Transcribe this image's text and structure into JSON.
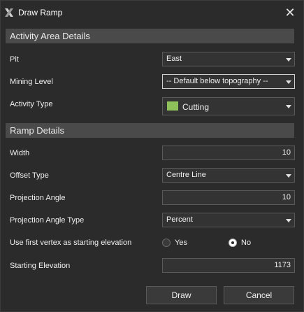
{
  "window": {
    "title": "Draw Ramp",
    "icon": "app-logo-icon",
    "close_icon": "close-icon",
    "close_symbol": "✕"
  },
  "activity_section": {
    "header": "Activity Area Details",
    "pit": {
      "label": "Pit",
      "value": "East"
    },
    "mining_level": {
      "label": "Mining Level",
      "value": "-- Default below topography --"
    },
    "activity_type": {
      "label": "Activity Type",
      "value": "Cutting",
      "swatch_color": "#8fc15a"
    }
  },
  "ramp_section": {
    "header": "Ramp Details",
    "width": {
      "label": "Width",
      "value": "10"
    },
    "offset_type": {
      "label": "Offset Type",
      "value": "Centre Line"
    },
    "projection_angle": {
      "label": "Projection Angle",
      "value": "10"
    },
    "projection_angle_type": {
      "label": "Projection Angle Type",
      "value": "Percent"
    },
    "first_vertex": {
      "label": "Use first vertex as starting elevation",
      "yes": "Yes",
      "no": "No",
      "selected": "No"
    },
    "starting_elevation": {
      "label": "Starting Elevation",
      "value": "1173"
    }
  },
  "buttons": {
    "draw": "Draw",
    "cancel": "Cancel"
  }
}
